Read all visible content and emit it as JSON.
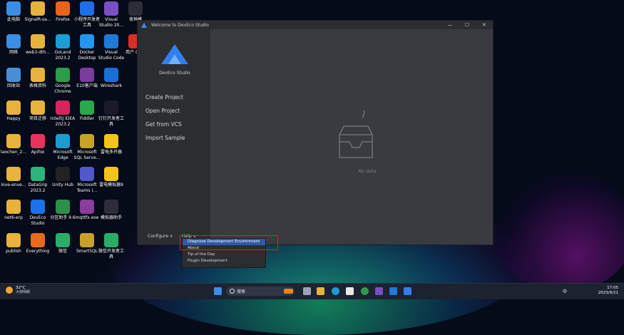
{
  "desktop": {
    "icons": [
      {
        "label": "此电脑",
        "color": "#3a8ee6"
      },
      {
        "label": "SignalR-sa...",
        "color": "#e8b33c"
      },
      {
        "label": "Firefox",
        "color": "#e8641c"
      },
      {
        "label": "小程序开发者工具",
        "color": "#1f6feb"
      },
      {
        "label": "Visual Studio 20...",
        "color": "#7b4fc4"
      },
      {
        "label": "夜神模",
        "color": "#2d2d3a"
      },
      {
        "label": "网络",
        "color": "#3a8ee6"
      },
      {
        "label": "web3-dth...",
        "color": "#e8b33c"
      },
      {
        "label": "GoLand 2023.2",
        "color": "#1a9ed6"
      },
      {
        "label": "Docker Desktop",
        "color": "#2496ed"
      },
      {
        "label": "Visual Studio Code",
        "color": "#1e7ad6"
      },
      {
        "label": "用户 Chro",
        "color": "#d93025"
      },
      {
        "label": "回收站",
        "color": "#4a8fd6"
      },
      {
        "label": "表格资料",
        "color": "#e8b33c"
      },
      {
        "label": "Google Chrome",
        "color": "#2c9c4a"
      },
      {
        "label": "E10客户端",
        "color": "#7a3d9c"
      },
      {
        "label": "Wireshark",
        "color": "#1a6fd6"
      },
      {
        "label": "Happy",
        "color": "#e8b33c"
      },
      {
        "label": "项目迁移",
        "color": "#e8b33c"
      },
      {
        "label": "IntelliJ IDEA 2023.2",
        "color": "#d6245c"
      },
      {
        "label": "Fiddler",
        "color": "#2aa84a"
      },
      {
        "label": "钉钉开发者工具",
        "color": "#1a1a2a"
      },
      {
        "label": "laochen_2...",
        "color": "#e8b33c"
      },
      {
        "label": "Apifox",
        "color": "#e8345c"
      },
      {
        "label": "Microsoft Edge",
        "color": "#1d9bd1"
      },
      {
        "label": "Microsoft SQL Serve...",
        "color": "#c8a12a"
      },
      {
        "label": "雷电多开器",
        "color": "#f0c419"
      },
      {
        "label": "love-enve...",
        "color": "#e8b33c"
      },
      {
        "label": "DataGrip 2023.2",
        "color": "#2ab57a"
      },
      {
        "label": "Unity Hub",
        "color": "#222"
      },
      {
        "label": "Microsoft Teams (...",
        "color": "#5059c9"
      },
      {
        "label": "雷电模拟器9",
        "color": "#f0c419"
      },
      {
        "label": "net6-erp",
        "color": "#e8b33c"
      },
      {
        "label": "DevEco Studio",
        "color": "#1a73e8"
      },
      {
        "label": "分区助手 9.6",
        "color": "#2d8f4a"
      },
      {
        "label": "mqttfx.exe",
        "color": "#8a3d9c"
      },
      {
        "label": "模拟器助手",
        "color": "#2d2d3a"
      },
      {
        "label": "publish",
        "color": "#e8b33c"
      },
      {
        "label": "Everything",
        "color": "#e86a1c"
      },
      {
        "label": "微信",
        "color": "#2aae67"
      },
      {
        "label": "SmartSQL",
        "color": "#c8a12a"
      },
      {
        "label": "微信开发者工具",
        "color": "#2aae67"
      }
    ]
  },
  "window": {
    "title": "Welcome to DevEco Studio",
    "brand": "DevEco Studio",
    "menu": [
      "Create Project",
      "Open Project",
      "Get from VCS",
      "Import Sample"
    ],
    "configure": "Configure ∨",
    "help": "Help ∨",
    "empty_text": "No data"
  },
  "help_menu": {
    "items": [
      "Diagnose Development Environment",
      "About",
      "Tip of the Day",
      "Plugin Development"
    ]
  },
  "taskbar": {
    "weather_temp": "32°C",
    "weather_desc": "大部晴朗",
    "search_label": "搜索",
    "lang": "中",
    "time": "17:05",
    "date": "2023/9/21"
  }
}
